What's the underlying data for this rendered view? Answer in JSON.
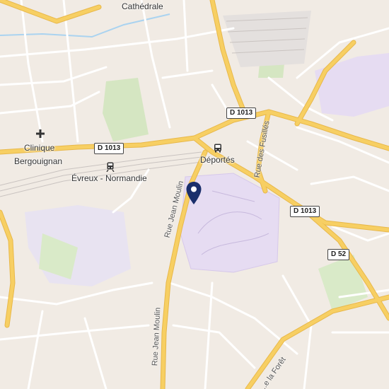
{
  "labels": {
    "cathedrale": "Cathédrale",
    "clinique_line1": "Clinique",
    "clinique_line2": "Bergouignan",
    "station": "Évreux - Normandie",
    "deportes": "Déportés"
  },
  "streets": {
    "jean_moulin_north": "Rue Jean Moulin",
    "jean_moulin_south": "Rue Jean Moulin",
    "fusilles": "Rue des Fusillés",
    "foret": "...e la Forêt"
  },
  "road_shields": {
    "d1013_north": "D 1013",
    "d1013_west": "D 1013",
    "d1013_east": "D 1013",
    "d52": "D 52"
  },
  "icons": {
    "clinic": "cross-icon",
    "station": "train-icon",
    "bus": "bus-icon",
    "pin": "map-pin-icon"
  },
  "colors": {
    "background": "#f1ebe4",
    "major_road": "#f7cf63",
    "minor_road": "#ffffff",
    "park": "#d6e8c4",
    "institution": "#e9e1f3",
    "pin": "#1a2f6b"
  }
}
